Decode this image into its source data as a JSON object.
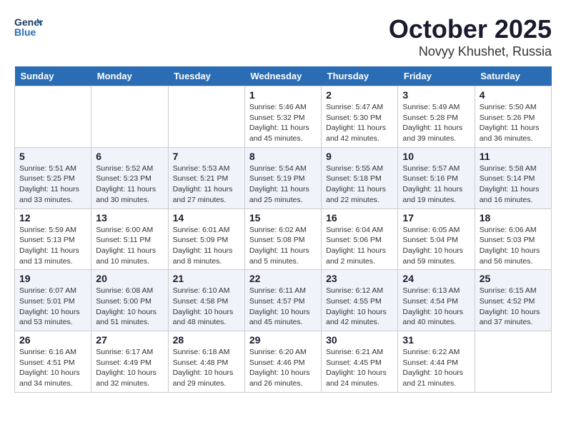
{
  "header": {
    "logo_line1": "General",
    "logo_line2": "Blue",
    "month": "October 2025",
    "location": "Novyy Khushet, Russia"
  },
  "days_of_week": [
    "Sunday",
    "Monday",
    "Tuesday",
    "Wednesday",
    "Thursday",
    "Friday",
    "Saturday"
  ],
  "weeks": [
    [
      {
        "day": "",
        "info": ""
      },
      {
        "day": "",
        "info": ""
      },
      {
        "day": "",
        "info": ""
      },
      {
        "day": "1",
        "info": "Sunrise: 5:46 AM\nSunset: 5:32 PM\nDaylight: 11 hours\nand 45 minutes."
      },
      {
        "day": "2",
        "info": "Sunrise: 5:47 AM\nSunset: 5:30 PM\nDaylight: 11 hours\nand 42 minutes."
      },
      {
        "day": "3",
        "info": "Sunrise: 5:49 AM\nSunset: 5:28 PM\nDaylight: 11 hours\nand 39 minutes."
      },
      {
        "day": "4",
        "info": "Sunrise: 5:50 AM\nSunset: 5:26 PM\nDaylight: 11 hours\nand 36 minutes."
      }
    ],
    [
      {
        "day": "5",
        "info": "Sunrise: 5:51 AM\nSunset: 5:25 PM\nDaylight: 11 hours\nand 33 minutes."
      },
      {
        "day": "6",
        "info": "Sunrise: 5:52 AM\nSunset: 5:23 PM\nDaylight: 11 hours\nand 30 minutes."
      },
      {
        "day": "7",
        "info": "Sunrise: 5:53 AM\nSunset: 5:21 PM\nDaylight: 11 hours\nand 27 minutes."
      },
      {
        "day": "8",
        "info": "Sunrise: 5:54 AM\nSunset: 5:19 PM\nDaylight: 11 hours\nand 25 minutes."
      },
      {
        "day": "9",
        "info": "Sunrise: 5:55 AM\nSunset: 5:18 PM\nDaylight: 11 hours\nand 22 minutes."
      },
      {
        "day": "10",
        "info": "Sunrise: 5:57 AM\nSunset: 5:16 PM\nDaylight: 11 hours\nand 19 minutes."
      },
      {
        "day": "11",
        "info": "Sunrise: 5:58 AM\nSunset: 5:14 PM\nDaylight: 11 hours\nand 16 minutes."
      }
    ],
    [
      {
        "day": "12",
        "info": "Sunrise: 5:59 AM\nSunset: 5:13 PM\nDaylight: 11 hours\nand 13 minutes."
      },
      {
        "day": "13",
        "info": "Sunrise: 6:00 AM\nSunset: 5:11 PM\nDaylight: 11 hours\nand 10 minutes."
      },
      {
        "day": "14",
        "info": "Sunrise: 6:01 AM\nSunset: 5:09 PM\nDaylight: 11 hours\nand 8 minutes."
      },
      {
        "day": "15",
        "info": "Sunrise: 6:02 AM\nSunset: 5:08 PM\nDaylight: 11 hours\nand 5 minutes."
      },
      {
        "day": "16",
        "info": "Sunrise: 6:04 AM\nSunset: 5:06 PM\nDaylight: 11 hours\nand 2 minutes."
      },
      {
        "day": "17",
        "info": "Sunrise: 6:05 AM\nSunset: 5:04 PM\nDaylight: 10 hours\nand 59 minutes."
      },
      {
        "day": "18",
        "info": "Sunrise: 6:06 AM\nSunset: 5:03 PM\nDaylight: 10 hours\nand 56 minutes."
      }
    ],
    [
      {
        "day": "19",
        "info": "Sunrise: 6:07 AM\nSunset: 5:01 PM\nDaylight: 10 hours\nand 53 minutes."
      },
      {
        "day": "20",
        "info": "Sunrise: 6:08 AM\nSunset: 5:00 PM\nDaylight: 10 hours\nand 51 minutes."
      },
      {
        "day": "21",
        "info": "Sunrise: 6:10 AM\nSunset: 4:58 PM\nDaylight: 10 hours\nand 48 minutes."
      },
      {
        "day": "22",
        "info": "Sunrise: 6:11 AM\nSunset: 4:57 PM\nDaylight: 10 hours\nand 45 minutes."
      },
      {
        "day": "23",
        "info": "Sunrise: 6:12 AM\nSunset: 4:55 PM\nDaylight: 10 hours\nand 42 minutes."
      },
      {
        "day": "24",
        "info": "Sunrise: 6:13 AM\nSunset: 4:54 PM\nDaylight: 10 hours\nand 40 minutes."
      },
      {
        "day": "25",
        "info": "Sunrise: 6:15 AM\nSunset: 4:52 PM\nDaylight: 10 hours\nand 37 minutes."
      }
    ],
    [
      {
        "day": "26",
        "info": "Sunrise: 6:16 AM\nSunset: 4:51 PM\nDaylight: 10 hours\nand 34 minutes."
      },
      {
        "day": "27",
        "info": "Sunrise: 6:17 AM\nSunset: 4:49 PM\nDaylight: 10 hours\nand 32 minutes."
      },
      {
        "day": "28",
        "info": "Sunrise: 6:18 AM\nSunset: 4:48 PM\nDaylight: 10 hours\nand 29 minutes."
      },
      {
        "day": "29",
        "info": "Sunrise: 6:20 AM\nSunset: 4:46 PM\nDaylight: 10 hours\nand 26 minutes."
      },
      {
        "day": "30",
        "info": "Sunrise: 6:21 AM\nSunset: 4:45 PM\nDaylight: 10 hours\nand 24 minutes."
      },
      {
        "day": "31",
        "info": "Sunrise: 6:22 AM\nSunset: 4:44 PM\nDaylight: 10 hours\nand 21 minutes."
      },
      {
        "day": "",
        "info": ""
      }
    ]
  ]
}
